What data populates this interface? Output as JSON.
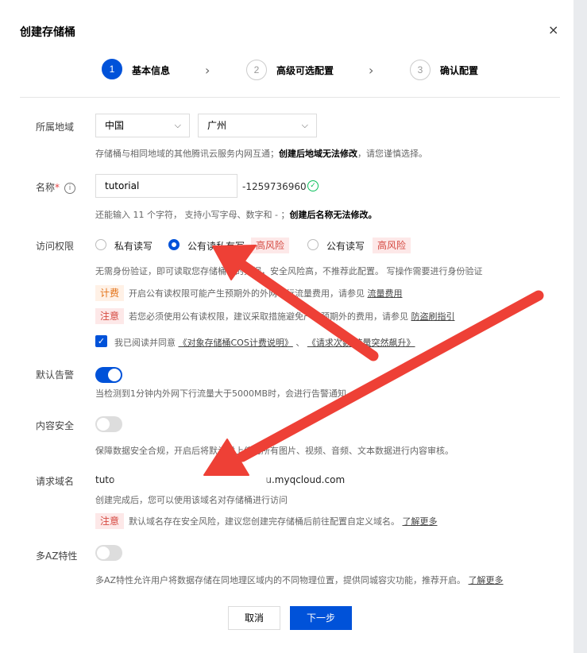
{
  "dialog": {
    "title": "创建存储桶",
    "close_glyph": "×",
    "steps": [
      {
        "number": "1",
        "label": "基本信息"
      },
      {
        "number": "2",
        "label": "高级可选配置"
      },
      {
        "number": "3",
        "label": "确认配置"
      }
    ]
  },
  "region": {
    "label": "所属地域",
    "country": "中国",
    "city": "广州",
    "hint_prefix": "存储桶与相同地域的其他腾讯云服务内网互通；",
    "hint_bold": "创建后地域无法修改",
    "hint_suffix": "，请您谨慎选择。"
  },
  "name": {
    "label": "名称",
    "required_mark": "*",
    "value": "tutorial",
    "suffix": "-1259736960",
    "hint_prefix": "还能输入 11 个字符， 支持小写字母、数字和 - ；",
    "hint_bold": "创建后名称无法修改。"
  },
  "access": {
    "label": "访问权限",
    "options": [
      "私有读写",
      "公有读私有写",
      "公有读写"
    ],
    "selected": "公有读私有写",
    "risk_badge": "高风险",
    "desc": "无需身份验证，即可读取您存储桶中的数据，安全风险高，不推荐此配置。 写操作需要进行身份验证",
    "fee_tag": "计费",
    "fee_text": "开启公有读权限可能产生预期外的外网下行流量费用，请参见",
    "fee_link": "流量费用",
    "note_tag": "注意",
    "note_text": "若您必须使用公有读权限，建议采取措施避免产生预期外的费用，请参见",
    "note_link": "防盗刷指引",
    "agree_text": "我已阅读并同意",
    "agree_link1": "《对象存储桶COS计费说明》",
    "agree_sep": "、",
    "agree_link2": "《请求次数/流量突然飙升》"
  },
  "alarm": {
    "label": "默认告警",
    "enabled": true,
    "hint": "当检测到1分钟内外网下行流量大于5000MB时，会进行告警通知。"
  },
  "content_security": {
    "label": "内容安全",
    "enabled": false,
    "hint": "保障数据安全合规，开启后将默认对上传的所有图片、视频、音频、文本数据进行内容审核。"
  },
  "request_domain": {
    "label": "请求域名",
    "domain_start": "tuto",
    "domain_end": "u.myqcloud.com",
    "hint": "创建完成后，您可以使用该域名对存储桶进行访问",
    "note_tag": "注意",
    "note_text": "默认域名存在安全风险，建议您创建完存储桶后前往配置自定义域名。",
    "note_link": "了解更多"
  },
  "multi_az": {
    "label": "多AZ特性",
    "enabled": false,
    "hint": "多AZ特性允许用户将数据存储在同地理区域内的不同物理位置，提供同城容灾功能，推荐开启。",
    "link": "了解更多"
  },
  "footer": {
    "cancel": "取消",
    "next": "下一步"
  },
  "colors": {
    "primary": "#0052d9",
    "risk": "#d54941",
    "fee": "#e37318",
    "annotation_arrow": "#ee4036",
    "success": "#0abf5b"
  }
}
